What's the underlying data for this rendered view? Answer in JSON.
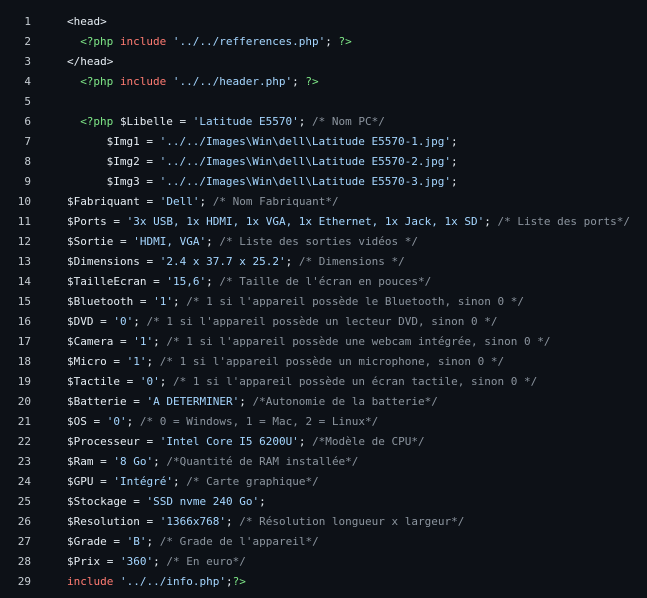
{
  "colors": {
    "background": "#0d1117",
    "text": "#e6edf3",
    "php_delim": "#7ee787",
    "keyword": "#ff7b72",
    "string": "#a5d6ff",
    "comment": "#8b949e"
  },
  "lines": [
    {
      "num": "1",
      "indent": 0,
      "tokens": [
        {
          "t": "tag",
          "v": "<head>"
        }
      ]
    },
    {
      "num": "2",
      "indent": 2,
      "tokens": [
        {
          "t": "pd",
          "v": "<?php"
        },
        {
          "t": "punc",
          "v": " "
        },
        {
          "t": "kw",
          "v": "include"
        },
        {
          "t": "punc",
          "v": " "
        },
        {
          "t": "str",
          "v": "'../../refferences.php'"
        },
        {
          "t": "punc",
          "v": "; "
        },
        {
          "t": "pd",
          "v": "?>"
        }
      ]
    },
    {
      "num": "3",
      "indent": 0,
      "tokens": [
        {
          "t": "tag",
          "v": "</head>"
        }
      ]
    },
    {
      "num": "4",
      "indent": 2,
      "tokens": [
        {
          "t": "pd",
          "v": "<?php"
        },
        {
          "t": "punc",
          "v": " "
        },
        {
          "t": "kw",
          "v": "include"
        },
        {
          "t": "punc",
          "v": " "
        },
        {
          "t": "str",
          "v": "'../../header.php'"
        },
        {
          "t": "punc",
          "v": "; "
        },
        {
          "t": "pd",
          "v": "?>"
        }
      ]
    },
    {
      "num": "5",
      "indent": 0,
      "tokens": []
    },
    {
      "num": "6",
      "indent": 2,
      "tokens": [
        {
          "t": "pd",
          "v": "<?php"
        },
        {
          "t": "punc",
          "v": " "
        },
        {
          "t": "var",
          "v": "$Libelle"
        },
        {
          "t": "op",
          "v": " = "
        },
        {
          "t": "str",
          "v": "'Latitude E5570'"
        },
        {
          "t": "punc",
          "v": "; "
        },
        {
          "t": "cm",
          "v": "/* Nom PC*/"
        }
      ]
    },
    {
      "num": "7",
      "indent": 6,
      "tokens": [
        {
          "t": "var",
          "v": "$Img1"
        },
        {
          "t": "op",
          "v": " = "
        },
        {
          "t": "str",
          "v": "'../../Images\\Win\\dell\\Latitude E5570-1.jpg'"
        },
        {
          "t": "punc",
          "v": ";"
        }
      ]
    },
    {
      "num": "8",
      "indent": 6,
      "tokens": [
        {
          "t": "var",
          "v": "$Img2"
        },
        {
          "t": "op",
          "v": " = "
        },
        {
          "t": "str",
          "v": "'../../Images\\Win\\dell\\Latitude E5570-2.jpg'"
        },
        {
          "t": "punc",
          "v": ";"
        }
      ]
    },
    {
      "num": "9",
      "indent": 6,
      "tokens": [
        {
          "t": "var",
          "v": "$Img3"
        },
        {
          "t": "op",
          "v": " = "
        },
        {
          "t": "str",
          "v": "'../../Images\\Win\\dell\\Latitude E5570-3.jpg'"
        },
        {
          "t": "punc",
          "v": ";"
        }
      ]
    },
    {
      "num": "10",
      "indent": 0,
      "tokens": [
        {
          "t": "var",
          "v": "$Fabriquant"
        },
        {
          "t": "op",
          "v": " = "
        },
        {
          "t": "str",
          "v": "'Dell'"
        },
        {
          "t": "punc",
          "v": "; "
        },
        {
          "t": "cm",
          "v": "/* Nom Fabriquant*/"
        }
      ]
    },
    {
      "num": "11",
      "indent": 0,
      "tokens": [
        {
          "t": "var",
          "v": "$Ports"
        },
        {
          "t": "op",
          "v": " = "
        },
        {
          "t": "str",
          "v": "'3x USB, 1x HDMI, 1x VGA, 1x Ethernet, 1x Jack, 1x SD'"
        },
        {
          "t": "punc",
          "v": "; "
        },
        {
          "t": "cm",
          "v": "/* Liste des ports*/"
        }
      ]
    },
    {
      "num": "12",
      "indent": 0,
      "tokens": [
        {
          "t": "var",
          "v": "$Sortie"
        },
        {
          "t": "op",
          "v": " = "
        },
        {
          "t": "str",
          "v": "'HDMI, VGA'"
        },
        {
          "t": "punc",
          "v": "; "
        },
        {
          "t": "cm",
          "v": "/* Liste des sorties vidéos */"
        }
      ]
    },
    {
      "num": "13",
      "indent": 0,
      "tokens": [
        {
          "t": "var",
          "v": "$Dimensions"
        },
        {
          "t": "op",
          "v": " = "
        },
        {
          "t": "str",
          "v": "'2.4 x 37.7 x 25.2'"
        },
        {
          "t": "punc",
          "v": "; "
        },
        {
          "t": "cm",
          "v": "/* Dimensions */"
        }
      ]
    },
    {
      "num": "14",
      "indent": 0,
      "tokens": [
        {
          "t": "var",
          "v": "$TailleEcran"
        },
        {
          "t": "op",
          "v": " = "
        },
        {
          "t": "str",
          "v": "'15,6'"
        },
        {
          "t": "punc",
          "v": "; "
        },
        {
          "t": "cm",
          "v": "/* Taille de l'écran en pouces*/"
        }
      ]
    },
    {
      "num": "15",
      "indent": 0,
      "tokens": [
        {
          "t": "var",
          "v": "$Bluetooth"
        },
        {
          "t": "op",
          "v": " = "
        },
        {
          "t": "str",
          "v": "'1'"
        },
        {
          "t": "punc",
          "v": "; "
        },
        {
          "t": "cm",
          "v": "/* 1 si l'appareil possède le Bluetooth, sinon 0 */"
        }
      ]
    },
    {
      "num": "16",
      "indent": 0,
      "tokens": [
        {
          "t": "var",
          "v": "$DVD"
        },
        {
          "t": "op",
          "v": " = "
        },
        {
          "t": "str",
          "v": "'0'"
        },
        {
          "t": "punc",
          "v": "; "
        },
        {
          "t": "cm",
          "v": "/* 1 si l'appareil possède un lecteur DVD, sinon 0 */"
        }
      ]
    },
    {
      "num": "17",
      "indent": 0,
      "tokens": [
        {
          "t": "var",
          "v": "$Camera"
        },
        {
          "t": "op",
          "v": " = "
        },
        {
          "t": "str",
          "v": "'1'"
        },
        {
          "t": "punc",
          "v": "; "
        },
        {
          "t": "cm",
          "v": "/* 1 si l'appareil possède une webcam intégrée, sinon 0 */"
        }
      ]
    },
    {
      "num": "18",
      "indent": 0,
      "tokens": [
        {
          "t": "var",
          "v": "$Micro"
        },
        {
          "t": "op",
          "v": " = "
        },
        {
          "t": "str",
          "v": "'1'"
        },
        {
          "t": "punc",
          "v": "; "
        },
        {
          "t": "cm",
          "v": "/* 1 si l'appareil possède un microphone, sinon 0 */"
        }
      ]
    },
    {
      "num": "19",
      "indent": 0,
      "tokens": [
        {
          "t": "var",
          "v": "$Tactile"
        },
        {
          "t": "op",
          "v": " = "
        },
        {
          "t": "str",
          "v": "'0'"
        },
        {
          "t": "punc",
          "v": "; "
        },
        {
          "t": "cm",
          "v": "/* 1 si l'appareil possède un écran tactile, sinon 0 */"
        }
      ]
    },
    {
      "num": "20",
      "indent": 0,
      "tokens": [
        {
          "t": "var",
          "v": "$Batterie"
        },
        {
          "t": "op",
          "v": " = "
        },
        {
          "t": "str",
          "v": "'A DETERMINER'"
        },
        {
          "t": "punc",
          "v": "; "
        },
        {
          "t": "cm",
          "v": "/*Autonomie de la batterie*/"
        }
      ]
    },
    {
      "num": "21",
      "indent": 0,
      "tokens": [
        {
          "t": "var",
          "v": "$OS"
        },
        {
          "t": "op",
          "v": " = "
        },
        {
          "t": "str",
          "v": "'0'"
        },
        {
          "t": "punc",
          "v": "; "
        },
        {
          "t": "cm",
          "v": "/* 0 = Windows, 1 = Mac, 2 = Linux*/"
        }
      ]
    },
    {
      "num": "22",
      "indent": 0,
      "tokens": [
        {
          "t": "var",
          "v": "$Processeur"
        },
        {
          "t": "op",
          "v": " = "
        },
        {
          "t": "str",
          "v": "'Intel Core I5 6200U'"
        },
        {
          "t": "punc",
          "v": "; "
        },
        {
          "t": "cm",
          "v": "/*Modèle de CPU*/"
        }
      ]
    },
    {
      "num": "23",
      "indent": 0,
      "tokens": [
        {
          "t": "var",
          "v": "$Ram"
        },
        {
          "t": "op",
          "v": " = "
        },
        {
          "t": "str",
          "v": "'8 Go'"
        },
        {
          "t": "punc",
          "v": "; "
        },
        {
          "t": "cm",
          "v": "/*Quantité de RAM installée*/"
        }
      ]
    },
    {
      "num": "24",
      "indent": 0,
      "tokens": [
        {
          "t": "var",
          "v": "$GPU"
        },
        {
          "t": "op",
          "v": " = "
        },
        {
          "t": "str",
          "v": "'Intégré'"
        },
        {
          "t": "punc",
          "v": "; "
        },
        {
          "t": "cm",
          "v": "/* Carte graphique*/"
        }
      ]
    },
    {
      "num": "25",
      "indent": 0,
      "tokens": [
        {
          "t": "var",
          "v": "$Stockage"
        },
        {
          "t": "op",
          "v": " = "
        },
        {
          "t": "str",
          "v": "'SSD nvme 240 Go'"
        },
        {
          "t": "punc",
          "v": ";"
        }
      ]
    },
    {
      "num": "26",
      "indent": 0,
      "tokens": [
        {
          "t": "var",
          "v": "$Resolution"
        },
        {
          "t": "op",
          "v": " = "
        },
        {
          "t": "str",
          "v": "'1366x768'"
        },
        {
          "t": "punc",
          "v": "; "
        },
        {
          "t": "cm",
          "v": "/* Résolution longueur x largeur*/"
        }
      ]
    },
    {
      "num": "27",
      "indent": 0,
      "tokens": [
        {
          "t": "var",
          "v": "$Grade"
        },
        {
          "t": "op",
          "v": " = "
        },
        {
          "t": "str",
          "v": "'B'"
        },
        {
          "t": "punc",
          "v": "; "
        },
        {
          "t": "cm",
          "v": "/* Grade de l'appareil*/"
        }
      ]
    },
    {
      "num": "28",
      "indent": 0,
      "tokens": [
        {
          "t": "var",
          "v": "$Prix"
        },
        {
          "t": "op",
          "v": " = "
        },
        {
          "t": "str",
          "v": "'360'"
        },
        {
          "t": "punc",
          "v": "; "
        },
        {
          "t": "cm",
          "v": "/* En euro*/"
        }
      ]
    },
    {
      "num": "29",
      "indent": 0,
      "tokens": [
        {
          "t": "kw",
          "v": "include"
        },
        {
          "t": "punc",
          "v": " "
        },
        {
          "t": "str",
          "v": "'../../info.php'"
        },
        {
          "t": "punc",
          "v": ";"
        },
        {
          "t": "pd",
          "v": "?>"
        }
      ]
    }
  ]
}
